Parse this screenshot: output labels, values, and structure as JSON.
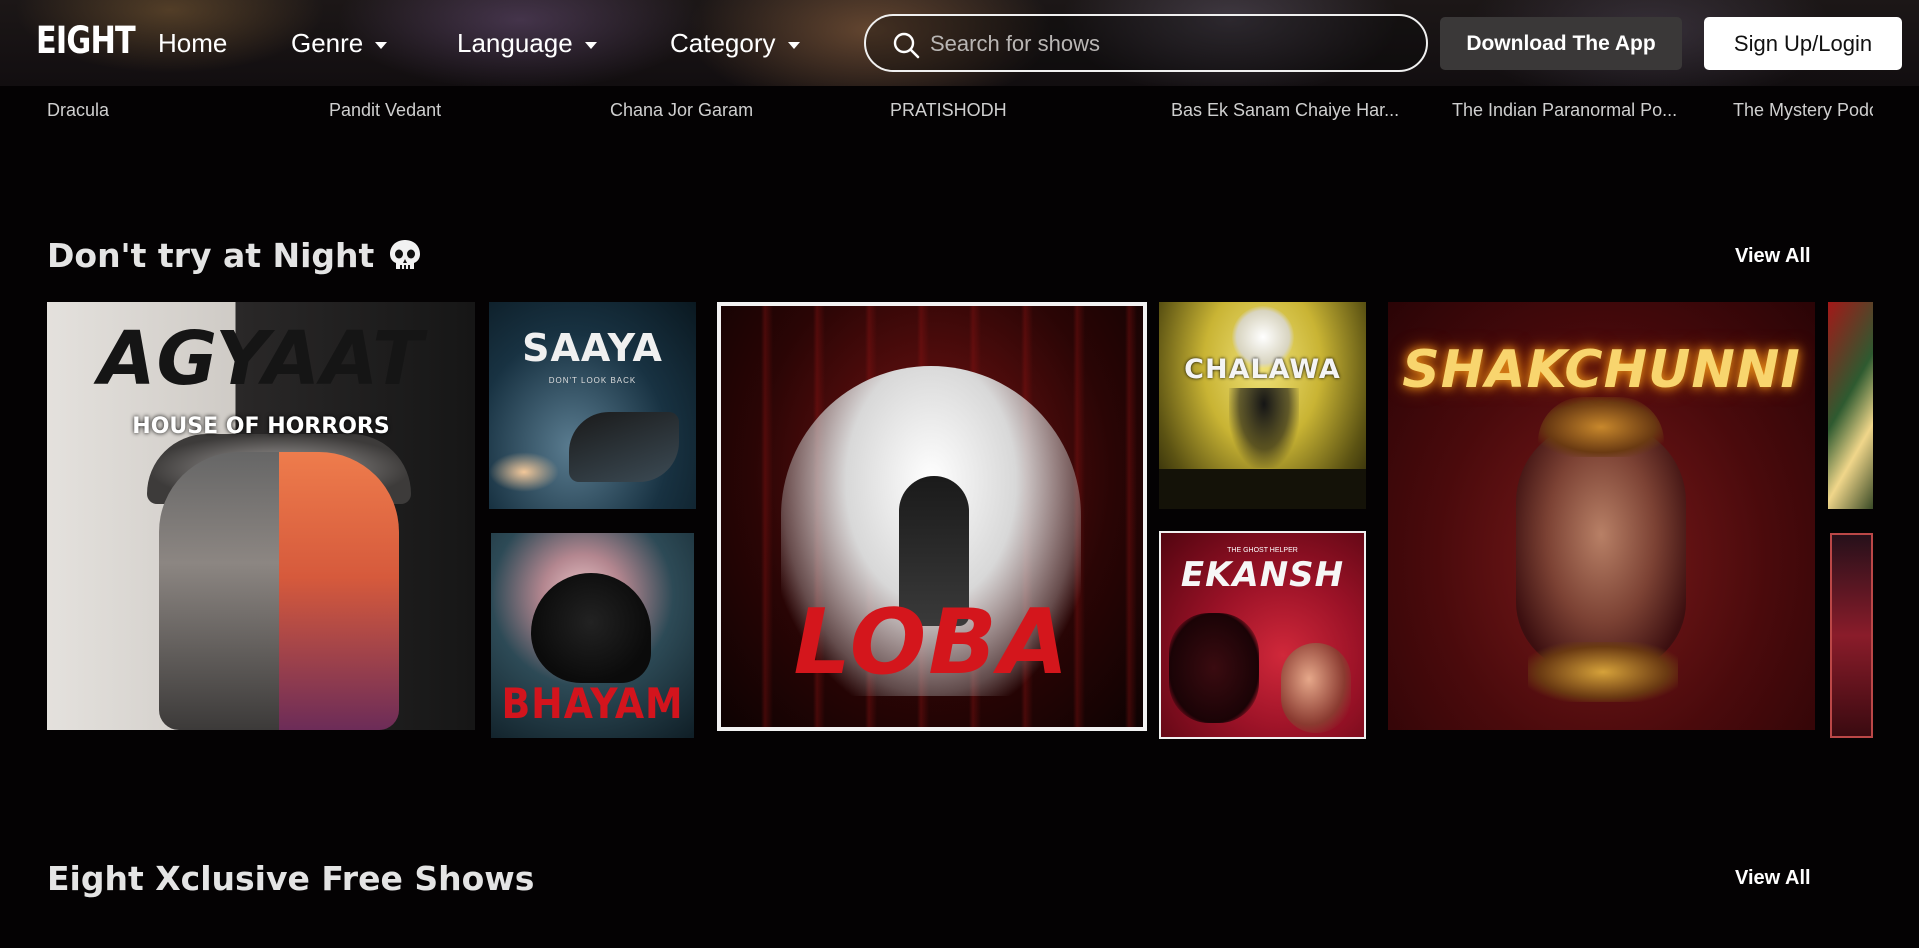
{
  "app": {
    "logo": "EIGHT"
  },
  "nav": {
    "home": "Home",
    "genre": "Genre",
    "language": "Language",
    "category": "Category"
  },
  "search": {
    "placeholder": "Search for shows"
  },
  "buttons": {
    "download_app": "Download The App",
    "login": "Sign Up/Login"
  },
  "title_strip": [
    "Dracula",
    "Pandit Vedant",
    "Chana Jor Garam",
    "PRATISHODH",
    "Bas Ek Sanam Chaiye Har...",
    "The Indian Paranormal Po...",
    "The Mystery Podcast"
  ],
  "sections": [
    {
      "title": "Don't try at Night",
      "title_icon": "skull-icon",
      "view_all": "View All",
      "cards": {
        "agyaat": {
          "title": "AGYAAT",
          "subtitle": "HOUSE OF HORRORS"
        },
        "saaya": {
          "title": "SAAYA",
          "tagline": "DON'T LOOK BACK"
        },
        "bhayam": {
          "title": "BHAYAM"
        },
        "loba": {
          "title": "LOBA"
        },
        "chalawa": {
          "title": "CHALAWA"
        },
        "ekansh": {
          "title": "EKANSH",
          "tagline": "THE GHOST HELPER"
        },
        "shakchunni": {
          "title": "SHAKCHUNNI"
        }
      }
    },
    {
      "title": "Eight Xclusive Free Shows",
      "view_all": "View All"
    }
  ],
  "colors": {
    "background": "#040203",
    "accent_red": "#d4161c",
    "button_dark": "#3a3838",
    "button_light": "#ffffff"
  }
}
